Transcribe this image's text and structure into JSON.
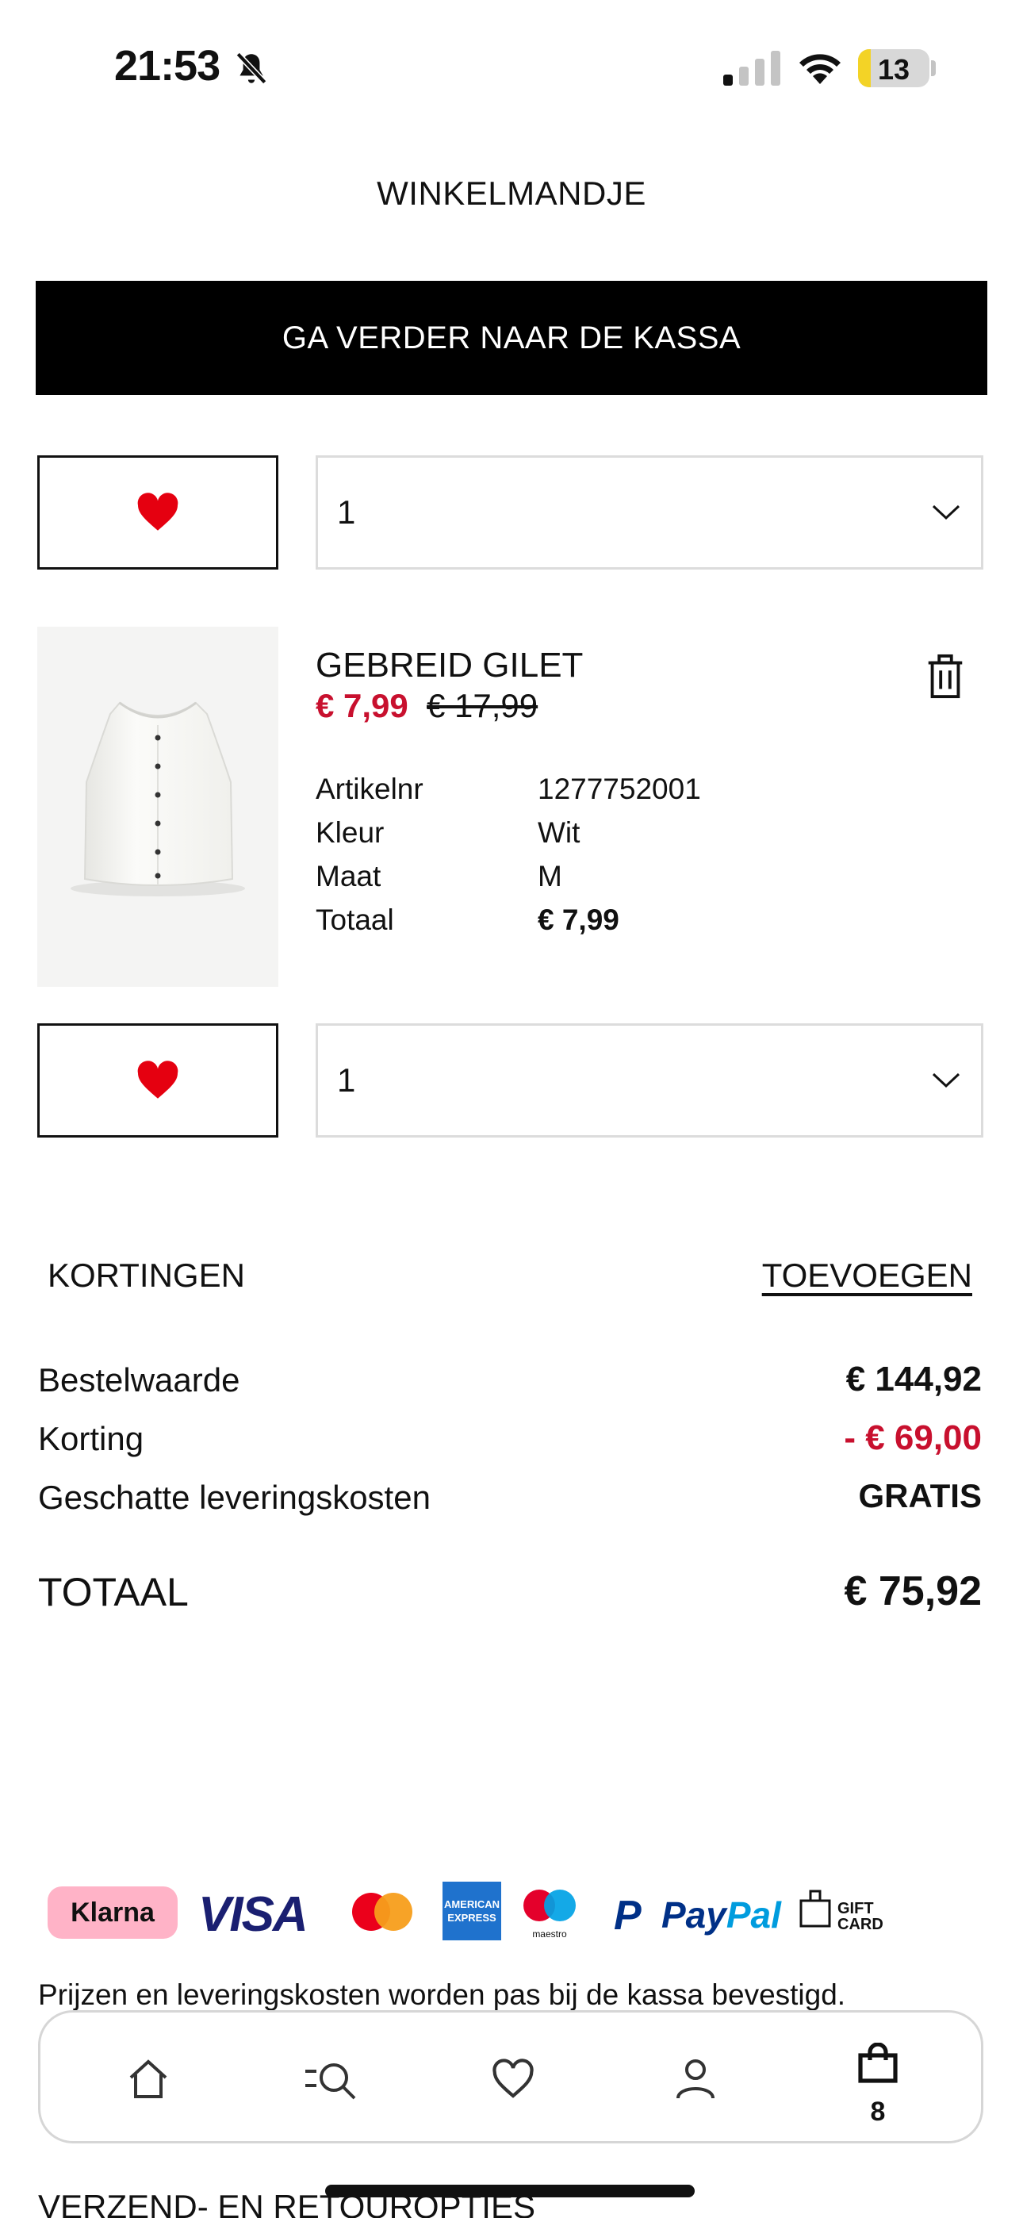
{
  "status_bar": {
    "time": "21:53",
    "battery": "13"
  },
  "header": {
    "title": "WINKELMANDJE"
  },
  "checkout_button": "GA VERDER NAAR DE KASSA",
  "items": [
    {
      "quantity": "1"
    },
    {
      "name": "GEBREID GILET",
      "price_current": "€ 7,99",
      "price_original": "€ 17,99",
      "specs": [
        {
          "label": "Artikelnr",
          "value": "1277752001"
        },
        {
          "label": "Kleur",
          "value": "Wit"
        },
        {
          "label": "Maat",
          "value": "M"
        },
        {
          "label": "Totaal",
          "value": "€ 7,99"
        }
      ],
      "quantity": "1"
    }
  ],
  "discounts": {
    "label": "KORTINGEN",
    "add_link": "TOEVOEGEN"
  },
  "summary": [
    {
      "label": "Bestelwaarde",
      "value": "€ 144,92",
      "color": "#111111"
    },
    {
      "label": "Korting",
      "value": "- € 69,00",
      "color": "#c8102e"
    },
    {
      "label": "Geschatte leveringskosten",
      "value": "GRATIS",
      "color": "#111111"
    }
  ],
  "total": {
    "label": "TOTAAL",
    "value": "€ 75,92"
  },
  "payment_logos": [
    "Klarna",
    "VISA",
    "mastercard-icon",
    "AMERICAN EXPRESS",
    "maestro",
    "PayPal",
    "GIFT CARD"
  ],
  "notice": "Prijzen en leveringskosten worden pas bij de kassa bevestigd.",
  "shipping_heading": "VERZEND- EN RETOUROPTIES",
  "nav": {
    "cart_count": "8"
  },
  "colors": {
    "sale": "#c8102e",
    "heart": "#e50010",
    "klarna_pink": "#ffb3c7",
    "visa_blue": "#1a1f71",
    "amex_blue": "#1f72cd",
    "paypal_dark": "#003087",
    "paypal_light": "#009cde"
  }
}
